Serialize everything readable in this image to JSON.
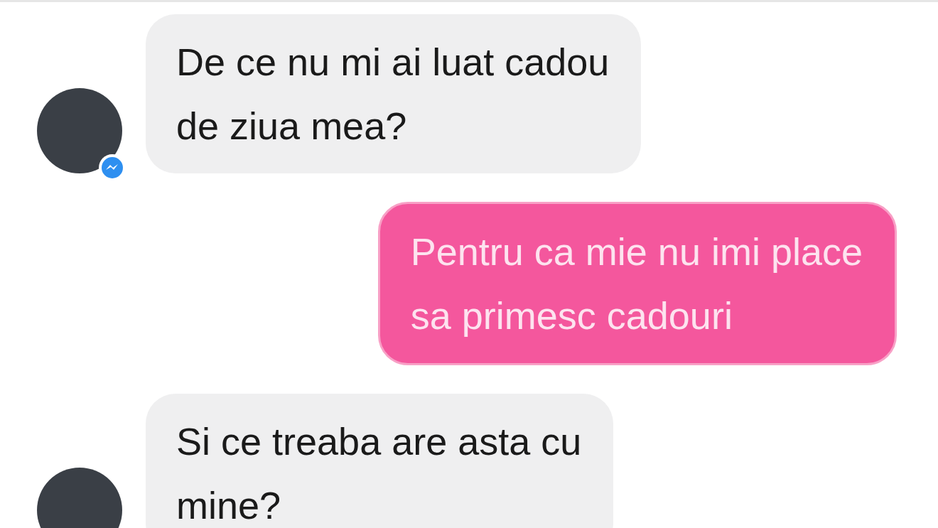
{
  "messages": [
    {
      "kind": "incoming",
      "lines": [
        "De ce nu mi ai luat cadou",
        "de ziua mea?"
      ]
    },
    {
      "kind": "outgoing",
      "lines": [
        "Pentru ca mie nu imi place",
        "sa primesc cadouri"
      ]
    },
    {
      "kind": "incoming",
      "lines": [
        "Si ce treaba are asta cu",
        "mine?"
      ]
    }
  ]
}
